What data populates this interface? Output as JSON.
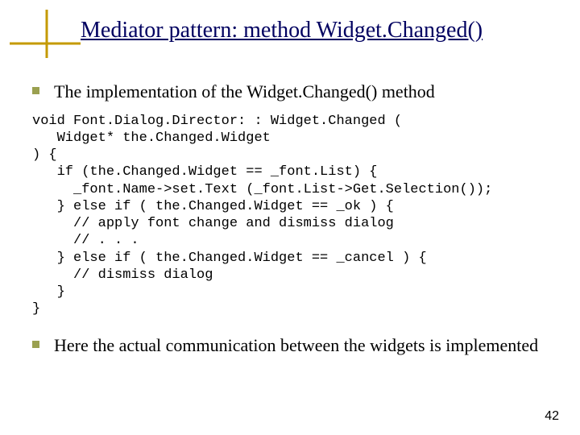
{
  "title": "Mediator pattern: method Widget.Changed()",
  "bullets": {
    "first": "The implementation of the Widget.Changed() method",
    "second": "Here the actual communication between the widgets is implemented"
  },
  "code_lines": [
    "void Font.Dialog.Director: : Widget.Changed (",
    "   Widget* the.Changed.Widget",
    ") {",
    "   if (the.Changed.Widget == _font.List) {",
    "     _font.Name->set.Text (_font.List->Get.Selection());",
    "   } else if ( the.Changed.Widget == _ok ) {",
    "     // apply font change and dismiss dialog",
    "     // . . .",
    "   } else if ( the.Changed.Widget == _cancel ) {",
    "     // dismiss dialog",
    "   }",
    "}"
  ],
  "page_number": "42"
}
